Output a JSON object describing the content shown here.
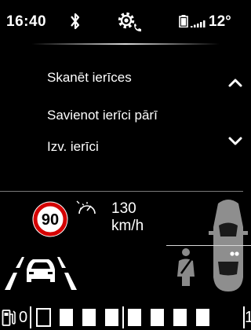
{
  "status_bar": {
    "time": "16:40",
    "temperature": "12°",
    "icons": [
      "bluetooth-icon",
      "settings-phone-icon",
      "battery-icon",
      "signal-icon"
    ]
  },
  "menu": {
    "items": [
      {
        "label": "Skanēt ierīces"
      },
      {
        "label": "Savienot ierīci pārī"
      },
      {
        "label": "Izv. ierīci"
      }
    ],
    "scroll_up_icon": "chevron-up-icon",
    "scroll_down_icon": "chevron-down-icon"
  },
  "driving": {
    "speed_limit": "90",
    "cruise_speed": "130",
    "cruise_unit": "km/h",
    "icons": [
      "speed-limit-sign-icon",
      "cruise-control-icon",
      "lane-assist-icon",
      "seatbelt-warning-icon",
      "car-top-view-icon"
    ]
  },
  "fuel": {
    "min_label": "0",
    "max_label": "1",
    "total_segments": 8,
    "filled_segments": 7,
    "icon": "fuel-pump-icon"
  },
  "colors": {
    "background": "#000000",
    "foreground": "#ffffff",
    "speed_sign_ring": "#d40000"
  }
}
